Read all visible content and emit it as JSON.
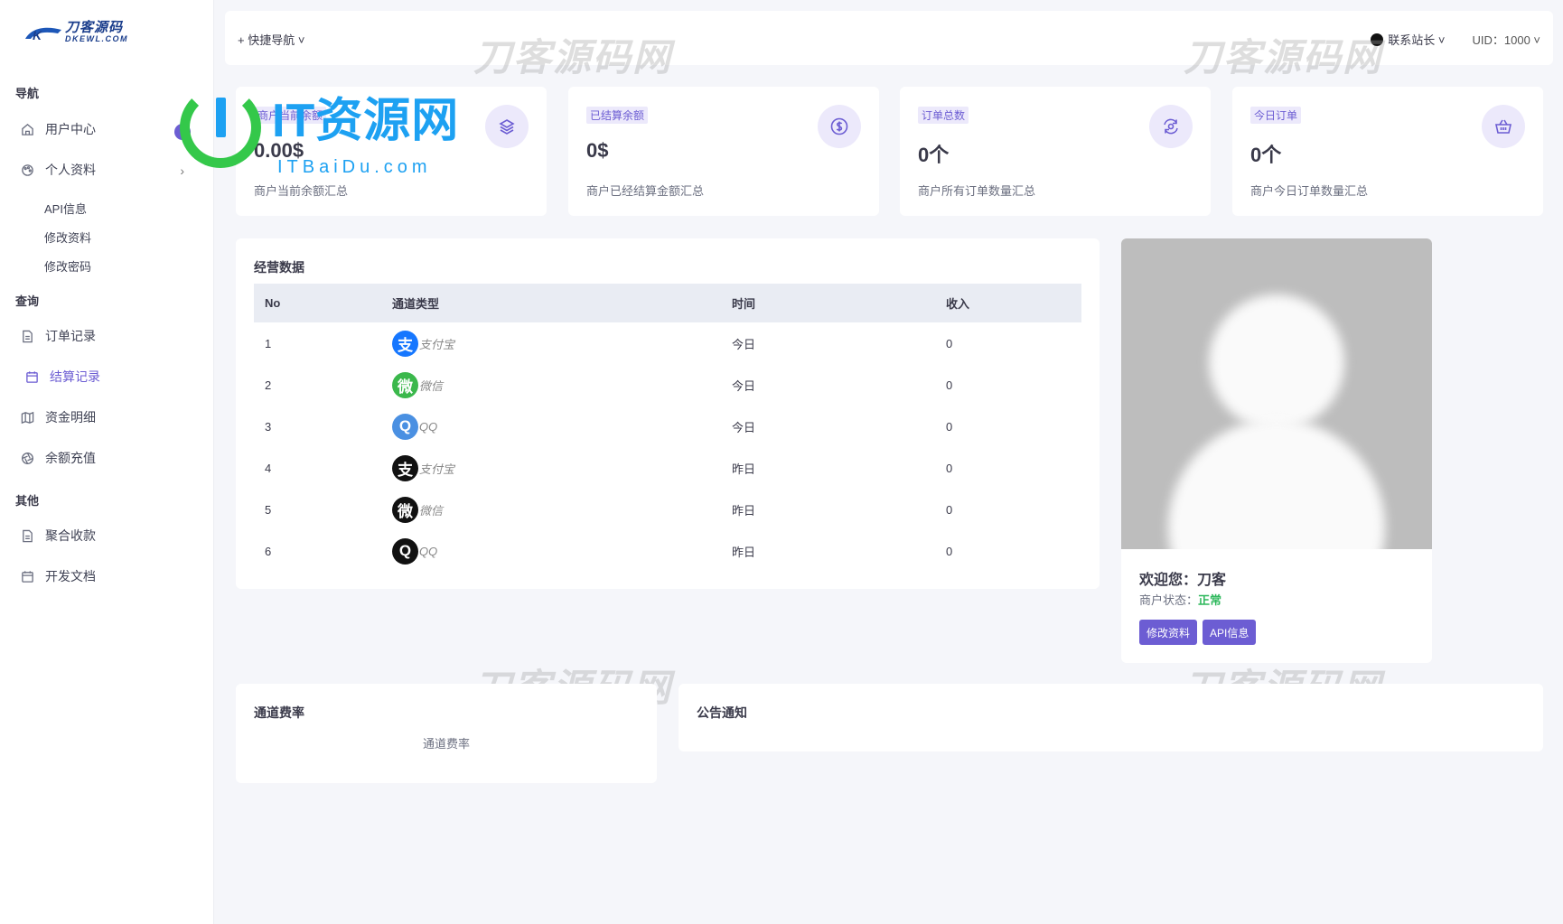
{
  "brand": {
    "name": "刀客源码",
    "domain": "DKEWL.COM"
  },
  "sidebar": {
    "sections": [
      "导航",
      "查询",
      "其他"
    ],
    "nav": {
      "user_center": "用户中心",
      "profile": "个人资料",
      "api_info": "API信息",
      "edit_profile": "修改资料",
      "change_password": "修改密码",
      "order_records": "订单记录",
      "settle_records": "结算记录",
      "fund_details": "资金明细",
      "balance_topup": "余额充值",
      "aggregate_pay": "聚合收款",
      "dev_docs": "开发文档"
    }
  },
  "header": {
    "quick_nav": "+ 快捷导航 ˅",
    "contact": "联系站长 ˅",
    "uid": "UID：1000 ˅"
  },
  "watermark": {
    "text": "刀客源码网",
    "it_title": "IT资源网",
    "it_sub": "ITBaiDu.com"
  },
  "stats": [
    {
      "badge": "商户当前余额",
      "value": "0.00$",
      "desc": "商户当前余额汇总",
      "icon": "layers-icon"
    },
    {
      "badge": "已结算余额",
      "value": "0$",
      "desc": "商户已经结算金额汇总",
      "icon": "dollar-icon"
    },
    {
      "badge": "订单总数",
      "value": "0个",
      "desc": "商户所有订单数量汇总",
      "icon": "refresh-icon"
    },
    {
      "badge": "今日订单",
      "value": "0个",
      "desc": "商户今日订单数量汇总",
      "icon": "basket-icon"
    }
  ],
  "business": {
    "title": "经营数据",
    "columns": [
      "No",
      "通道类型",
      "时间",
      "收入"
    ],
    "rows": [
      {
        "no": "1",
        "channel": "支付宝",
        "time": "今日",
        "income": "0",
        "icon_color": "#1677ff",
        "glyph": "支",
        "income_color": "orange"
      },
      {
        "no": "2",
        "channel": "微信",
        "time": "今日",
        "income": "0",
        "icon_color": "#3bb84c",
        "glyph": "微",
        "income_color": "green"
      },
      {
        "no": "3",
        "channel": "QQ",
        "time": "今日",
        "income": "0",
        "icon_color": "#4a90e2",
        "glyph": "Q",
        "income_color": "red"
      },
      {
        "no": "4",
        "channel": "支付宝",
        "time": "昨日",
        "income": "0",
        "icon_color": "#111111",
        "glyph": "支",
        "income_color": "orange"
      },
      {
        "no": "5",
        "channel": "微信",
        "time": "昨日",
        "income": "0",
        "icon_color": "#111111",
        "glyph": "微",
        "income_color": "orange"
      },
      {
        "no": "6",
        "channel": "QQ",
        "time": "昨日",
        "income": "0",
        "icon_color": "#111111",
        "glyph": "Q",
        "income_color": "red"
      }
    ]
  },
  "profile": {
    "welcome": "欢迎您：刀客",
    "status_label": "商户状态：",
    "status_value": "正常",
    "btn_edit": "修改资料",
    "btn_api": "API信息"
  },
  "rate": {
    "title": "通道费率",
    "text": "通道费率"
  },
  "notice": {
    "title": "公告通知"
  },
  "colors": {
    "accent": "#6c5dd3",
    "accent_light": "#ece9fb",
    "success": "#2eb85c",
    "danger": "#e94b4b"
  }
}
